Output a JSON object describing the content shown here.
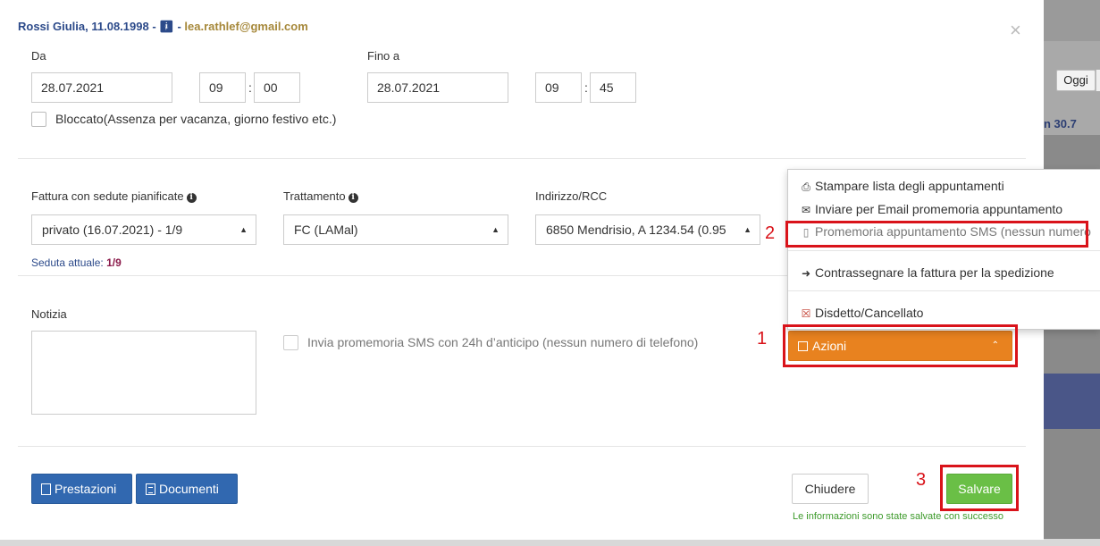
{
  "header": {
    "patient": "Rossi Giulia, 11.08.1998",
    "separator": "-",
    "gender_icon": "female-icon",
    "email": "lea.rathlef@gmail.com"
  },
  "close_glyph": "×",
  "from": {
    "label": "Da",
    "date": "28.07.2021",
    "hour": "09",
    "minute": "00"
  },
  "to": {
    "label": "Fino a",
    "date": "28.07.2021",
    "hour": "09",
    "minute": "45"
  },
  "time_sep": ":",
  "blocked_label": "Bloccato(Assenza per vacanza, giorno festivo etc.)",
  "invoice": {
    "label": "Fattura con sedute pianificate",
    "value": "privato (16.07.2021) - 1/9"
  },
  "treatment": {
    "label": "Trattamento",
    "value": "FC (LAMal)"
  },
  "address": {
    "label": "Indirizzo/RCC",
    "value": "6850 Mendrisio, A 1234.54 (0.95"
  },
  "seduta": {
    "label": "Seduta attuale:",
    "value": "1/9"
  },
  "notizia_label": "Notizia",
  "sms_label": "Invia promemoria SMS con 24h d’anticipo (nessun numero di telefono)",
  "buttons": {
    "prestazioni": "Prestazioni",
    "documenti": "Documenti",
    "chiudere": "Chiudere",
    "salvare": "Salvare",
    "azioni": "Azioni"
  },
  "saved_message": "Le informazioni sono state salvate con successo",
  "menu": {
    "print": "Stampare lista degli appuntamenti",
    "email": "Inviare per Email promemoria appuntamento",
    "sms": "Promemoria appuntamento SMS (nessun numero",
    "mark_invoice": "Contrassegnare la fattura per la spedizione",
    "cancel": "Disdetto/Cancellato"
  },
  "annotations": {
    "n1": "1",
    "n2": "2",
    "n3": "3"
  },
  "background": {
    "oggi": "Oggi",
    "date": "n 30.7"
  },
  "colors": {
    "accent_blue": "#3168b0",
    "orange": "#e8821f",
    "green": "#6abf46",
    "highlight_red": "#d9131a"
  }
}
